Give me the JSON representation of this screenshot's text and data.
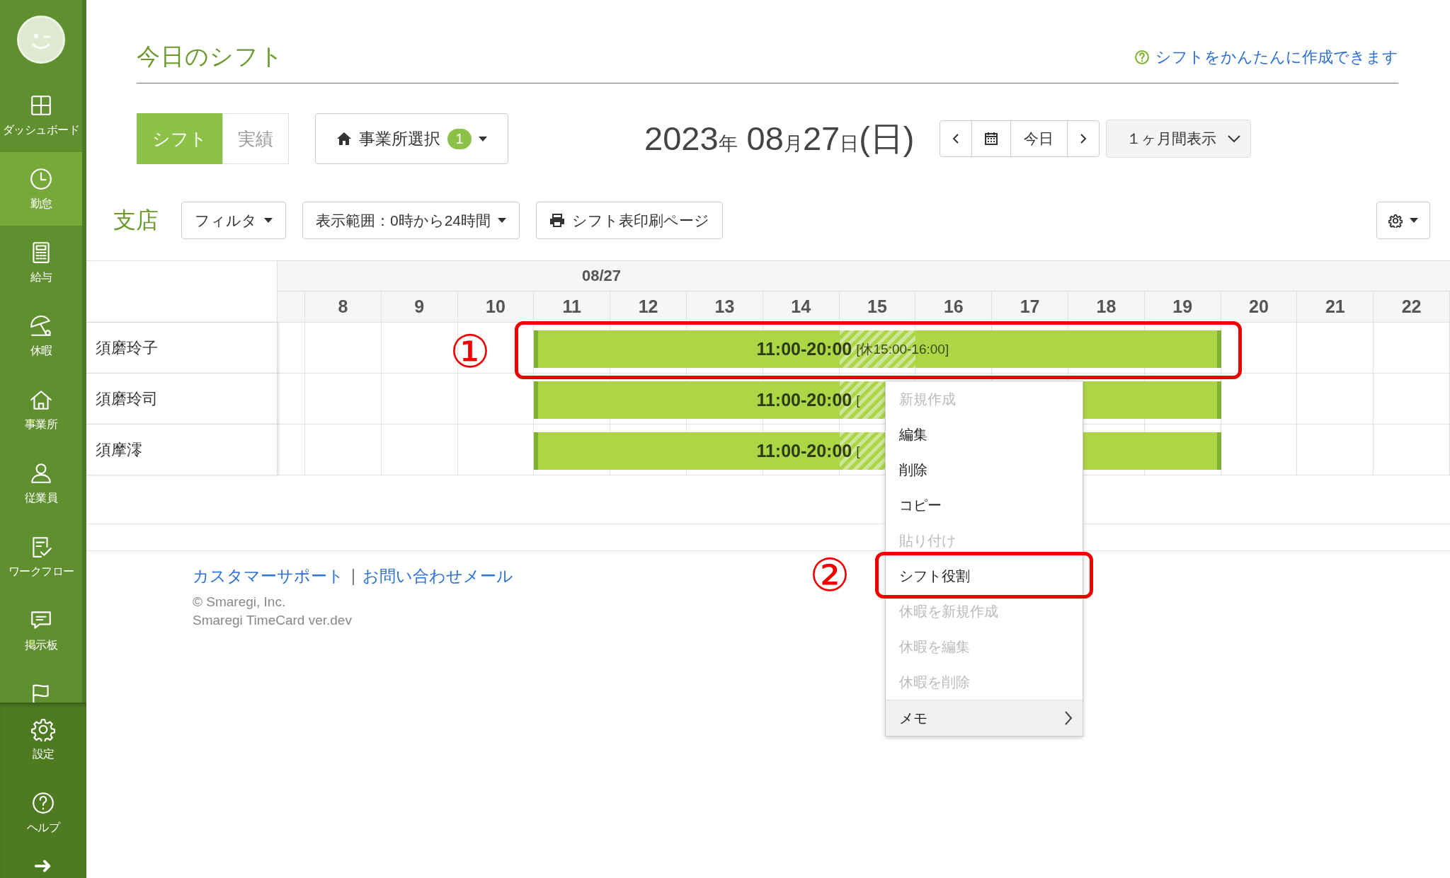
{
  "sidebar": {
    "items": [
      {
        "label": "ダッシュボード",
        "selected": false
      },
      {
        "label": "勤怠",
        "selected": true
      },
      {
        "label": "給与",
        "selected": false
      },
      {
        "label": "休暇",
        "selected": false
      },
      {
        "label": "事業所",
        "selected": false
      },
      {
        "label": "従業員",
        "selected": false
      },
      {
        "label": "ワークフロー",
        "selected": false
      },
      {
        "label": "掲示板",
        "selected": false
      }
    ],
    "bottom_items": [
      {
        "label": "設定"
      },
      {
        "label": "ヘルプ"
      }
    ]
  },
  "header": {
    "title": "今日のシフト",
    "help_link": "シフトをかんたんに作成できます"
  },
  "view_toggle": [
    {
      "label": "シフト",
      "selected": true
    },
    {
      "label": "実績",
      "selected": false
    }
  ],
  "office_select": {
    "label": "事業所選択",
    "badge": "1"
  },
  "date": {
    "year": "2023",
    "year_unit": "年",
    "month": "08",
    "month_unit": "月",
    "day": "27",
    "day_unit": "日",
    "weekday": "(日)"
  },
  "date_nav": {
    "today": "今日"
  },
  "range_select": {
    "value": "１ヶ月間表示"
  },
  "store": {
    "name": "支店"
  },
  "toolbar": {
    "filter": "フィルタ",
    "range": "表示範囲：0時から24時間",
    "print": "シフト表印刷ページ"
  },
  "schedule": {
    "date": "08/27",
    "hours": [
      "8",
      "9",
      "10",
      "11",
      "12",
      "13",
      "14",
      "15",
      "16",
      "17",
      "18",
      "19",
      "20",
      "21",
      "22"
    ],
    "rows": [
      {
        "name": "須磨玲子",
        "time": "11:00-20:00",
        "break_label": "[休15:00-16:00]"
      },
      {
        "name": "須磨玲司",
        "time": "11:00-20:00",
        "break_label": "["
      },
      {
        "name": "須摩澪",
        "time": "11:00-20:00",
        "break_label": "["
      }
    ]
  },
  "context_menu": {
    "items": [
      {
        "label": "新規作成",
        "disabled": true,
        "kind": "item"
      },
      {
        "label": "編集",
        "disabled": false,
        "kind": "item"
      },
      {
        "label": "削除",
        "disabled": false,
        "kind": "item"
      },
      {
        "label": "コピー",
        "disabled": false,
        "kind": "item"
      },
      {
        "label": "貼り付け",
        "disabled": true,
        "kind": "item"
      },
      {
        "label": "シフト役割",
        "disabled": false,
        "kind": "item"
      },
      {
        "label": "休暇を新規作成",
        "disabled": true,
        "kind": "item"
      },
      {
        "label": "休暇を編集",
        "disabled": true,
        "kind": "item"
      },
      {
        "label": "休暇を削除",
        "disabled": true,
        "kind": "item"
      },
      {
        "label": "メモ",
        "disabled": false,
        "kind": "submenu"
      }
    ]
  },
  "annotations": [
    {
      "label": "①"
    },
    {
      "label": "②"
    }
  ],
  "footer": {
    "links": [
      "カスタマーサポート",
      "お問い合わせメール"
    ],
    "separator": "|",
    "copyright": "© Smaregi, Inc.",
    "version": "Smaregi TimeCard ver.dev"
  }
}
